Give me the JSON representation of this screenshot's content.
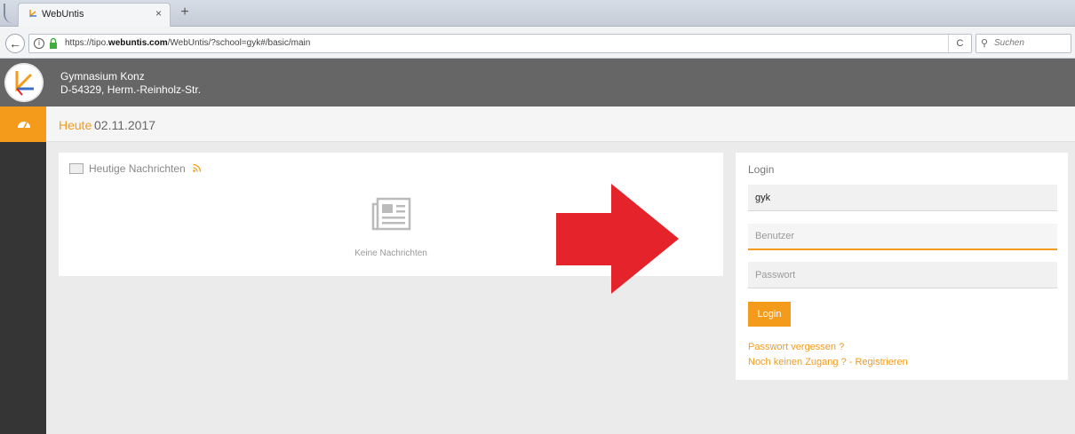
{
  "browser": {
    "tab_title": "WebUntis",
    "tab_close": "×",
    "new_tab": "+",
    "back": "←",
    "url_prefix": "https://tipo.",
    "url_domain": "webuntis.com",
    "url_suffix": "/WebUntis/?school=gyk#/basic/main",
    "reload": "C",
    "search_placeholder": "Suchen",
    "info": "i",
    "search_glyph": "⚲"
  },
  "header": {
    "school_name": "Gymnasium Konz",
    "school_address": "D-54329, Herm.-Reinholz-Str."
  },
  "datebar": {
    "today_label": "Heute",
    "date": "02.11.2017"
  },
  "news": {
    "title": "Heutige Nachrichten",
    "empty_text": "Keine Nachrichten",
    "rss_glyph": "ʺ"
  },
  "login": {
    "title": "Login",
    "school_value": "gyk",
    "user_placeholder": "Benutzer",
    "password_placeholder": "Passwort",
    "button_label": "Login",
    "forgot_link": "Passwort vergessen ?",
    "register_link": "Noch keinen Zugang ? - Registrieren"
  },
  "colors": {
    "accent": "#f49b1c",
    "header_bg": "#666666",
    "sidebar_bg": "#353535",
    "arrow": "#e5232a"
  },
  "icons": {
    "sidebar": "dashboard-icon",
    "news": "newspaper-icon",
    "rss": "rss-icon",
    "lock": "lock-icon"
  }
}
